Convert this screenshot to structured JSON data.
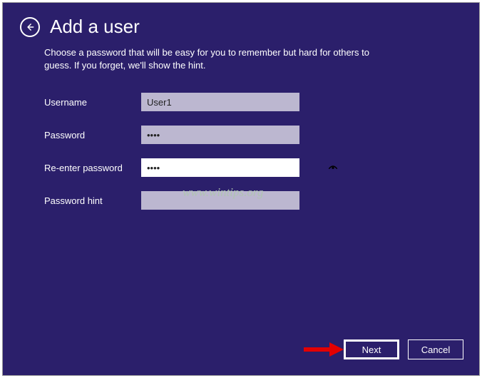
{
  "header": {
    "title": "Add a user",
    "back_icon": "back-arrow-icon"
  },
  "subtitle": "Choose a password that will be easy for you to remember but hard for others to guess. If you forget, we'll show the hint.",
  "form": {
    "username": {
      "label": "Username",
      "value": "User1"
    },
    "password": {
      "label": "Password",
      "value": "••••"
    },
    "reenter": {
      "label": "Re-enter password",
      "value": "••••"
    },
    "hint": {
      "label": "Password hint",
      "value": ""
    }
  },
  "footer": {
    "next": "Next",
    "cancel": "Cancel"
  },
  "watermark": "www.wintips.org"
}
